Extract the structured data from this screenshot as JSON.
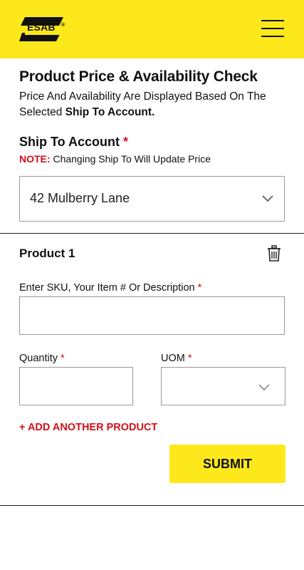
{
  "header": {
    "logo_text": "ESAB",
    "logo_mark": "®",
    "menu_icon": "hamburger-menu-icon",
    "background": "#fde81c"
  },
  "page": {
    "title": "Product Price & Availability Check",
    "description_prefix": "Price And Availability Are Displayed Based On The Selected",
    "description_bold": "Ship To Account."
  },
  "ship_to": {
    "label": "Ship To Account",
    "required_mark": "*",
    "note_label": "NOTE:",
    "note_text": "Changing Ship To Will Update Price",
    "selected_value": "42 Mulberry Lane",
    "icon": "chevron-down-icon"
  },
  "product": {
    "title": "Product 1",
    "delete_icon": "trash-icon",
    "sku_label": "Enter SKU, Your Item # Or Description",
    "sku_value": "",
    "quantity_label": "Quantity",
    "quantity_value": "",
    "uom_label": "UOM",
    "uom_value": "",
    "required_mark": "*"
  },
  "actions": {
    "add_another": "+ ADD ANOTHER PRODUCT",
    "submit": "SUBMIT"
  },
  "colors": {
    "accent_yellow": "#fde81c",
    "required_red": "#d0111b"
  }
}
